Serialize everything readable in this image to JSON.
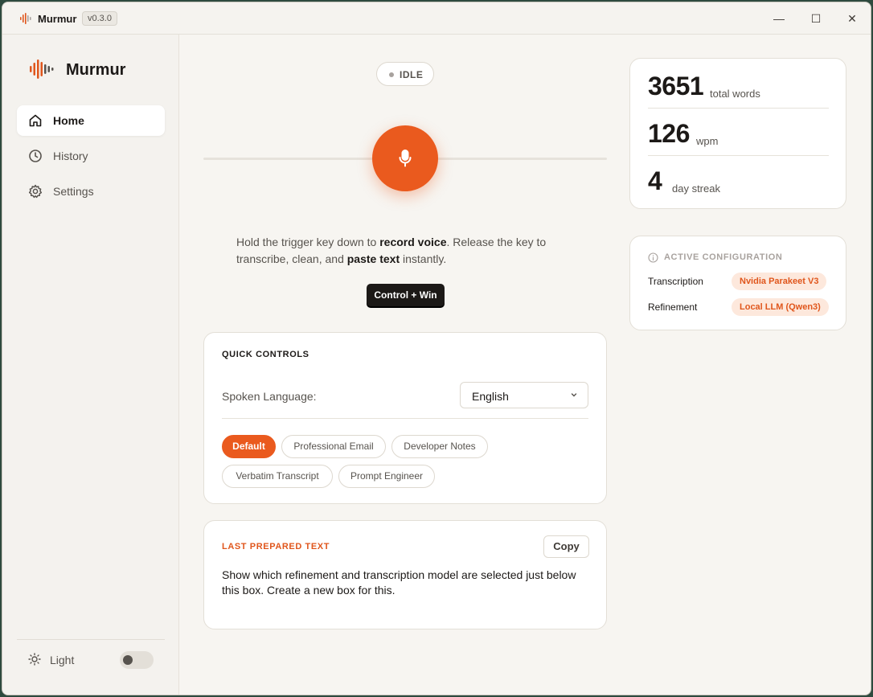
{
  "titlebar": {
    "app_name": "Murmur",
    "version": "v0.3.0",
    "minimize": "—",
    "maximize": "☐",
    "close": "✕"
  },
  "sidebar": {
    "brand": "Murmur",
    "nav": [
      {
        "label": "Home",
        "icon": "home-icon",
        "active": true
      },
      {
        "label": "History",
        "icon": "clock-icon",
        "active": false
      },
      {
        "label": "Settings",
        "icon": "gear-icon",
        "active": false
      }
    ],
    "theme_label": "Light",
    "theme_toggle_on": false
  },
  "recorder": {
    "status": "IDLE",
    "instructions": {
      "p1": "Hold the trigger key down to ",
      "b1": "record voice",
      "p2": ". Release the key to transcribe, clean, and ",
      "b2": "paste text",
      "p3": " instantly."
    },
    "hotkey": "Control + Win"
  },
  "quick_controls": {
    "title": "QUICK CONTROLS",
    "language_label": "Spoken Language:",
    "language_value": "English",
    "modes": [
      {
        "label": "Default",
        "active": true
      },
      {
        "label": "Professional Email",
        "active": false
      },
      {
        "label": "Developer Notes",
        "active": false
      },
      {
        "label": "Verbatim Transcript",
        "active": false
      },
      {
        "label": "Prompt Engineer",
        "active": false
      }
    ]
  },
  "last_prepared": {
    "title": "LAST PREPARED TEXT",
    "copy_label": "Copy",
    "text": "Show which refinement and transcription model are selected just below this box. Create a new box for this."
  },
  "stats": [
    {
      "value": "3651",
      "label": "total words"
    },
    {
      "value": "126",
      "label": "wpm"
    },
    {
      "value": "4",
      "label": "day streak"
    }
  ],
  "config": {
    "title": "ACTIVE CONFIGURATION",
    "rows": [
      {
        "label": "Transcription",
        "value": "Nvidia Parakeet V3"
      },
      {
        "label": "Refinement",
        "value": "Local LLM (Qwen3)"
      }
    ]
  },
  "colors": {
    "accent": "#ea5a1e",
    "badge_bg": "#fde8dc",
    "background": "#f7f5f1"
  }
}
